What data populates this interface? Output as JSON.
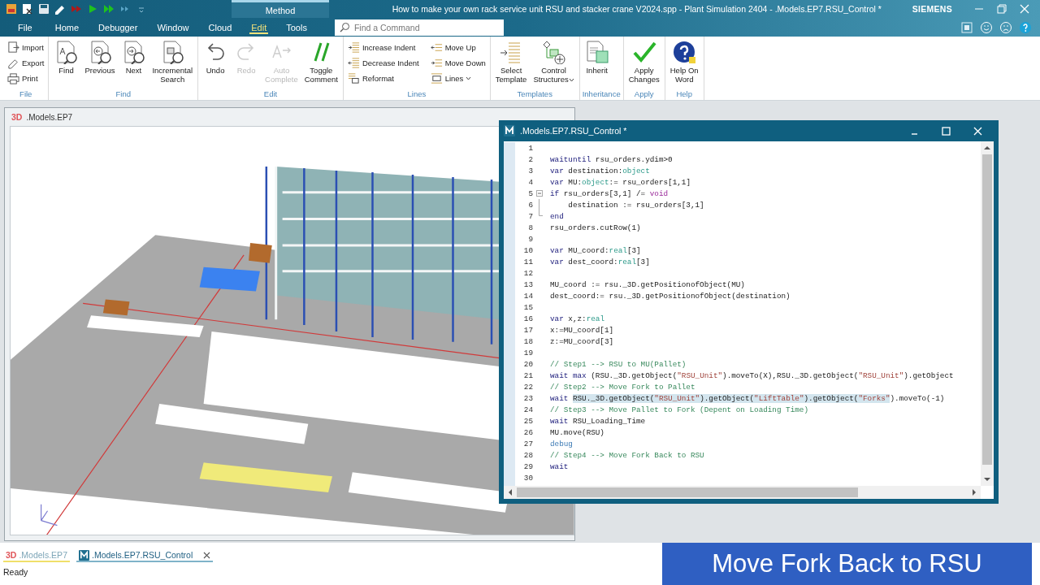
{
  "title_bar": {
    "context_tab": "Method",
    "title": "How to make your own rack service unit RSU and stacker crane V2024.spp - Plant Simulation 2404 - .Models.EP7.RSU_Control *",
    "brand": "SIEMENS"
  },
  "ribbon": {
    "tabs": [
      {
        "label": "File",
        "selected": false
      },
      {
        "label": "Home",
        "selected": false
      },
      {
        "label": "Debugger",
        "selected": false
      },
      {
        "label": "Window",
        "selected": false
      },
      {
        "label": "Cloud",
        "selected": false
      },
      {
        "label": "Edit",
        "selected": true
      },
      {
        "label": "Tools",
        "selected": false
      }
    ],
    "search": {
      "placeholder": "Find a Command"
    },
    "groups": [
      {
        "label": "File",
        "buttons": [
          {
            "kind": "small",
            "label": "Import",
            "disabled": false,
            "dropdown": false
          },
          {
            "kind": "small",
            "label": "Export",
            "disabled": false,
            "dropdown": false
          },
          {
            "kind": "small",
            "label": "Print",
            "disabled": false,
            "dropdown": false
          }
        ]
      },
      {
        "label": "Find",
        "buttons": [
          {
            "kind": "large",
            "label": "Find",
            "disabled": false,
            "dropdown": false
          },
          {
            "kind": "large",
            "label": "Previous",
            "disabled": false,
            "dropdown": false
          },
          {
            "kind": "large",
            "label": "Next",
            "disabled": false,
            "dropdown": false
          },
          {
            "kind": "large",
            "label": "Incremental\nSearch",
            "disabled": false,
            "dropdown": false
          }
        ]
      },
      {
        "label": "Edit",
        "buttons": [
          {
            "kind": "large",
            "label": "Undo",
            "disabled": false,
            "dropdown": false
          },
          {
            "kind": "large",
            "label": "Redo",
            "disabled": true,
            "dropdown": false
          },
          {
            "kind": "large",
            "label": "Auto\nComplete",
            "disabled": true,
            "dropdown": false
          },
          {
            "kind": "large",
            "label": "Toggle\nComment",
            "disabled": false,
            "dropdown": false
          }
        ]
      },
      {
        "label": "Lines",
        "buttons": [
          {
            "kind": "small",
            "label": "Increase Indent",
            "disabled": false,
            "dropdown": false
          },
          {
            "kind": "small",
            "label": "Decrease Indent",
            "disabled": false,
            "dropdown": false
          },
          {
            "kind": "small",
            "label": "Reformat",
            "disabled": false,
            "dropdown": false
          },
          {
            "kind": "small",
            "label": "Move Up",
            "disabled": false,
            "dropdown": false
          },
          {
            "kind": "small",
            "label": "Move Down",
            "disabled": false,
            "dropdown": false
          },
          {
            "kind": "small",
            "label": "Lines",
            "disabled": false,
            "dropdown": true
          }
        ]
      },
      {
        "label": "Templates",
        "buttons": [
          {
            "kind": "large",
            "label": "Select\nTemplate",
            "disabled": false,
            "dropdown": false
          },
          {
            "kind": "large",
            "label": "Control\nStructures",
            "disabled": false,
            "dropdown": true
          }
        ]
      },
      {
        "label": "Inheritance",
        "buttons": [
          {
            "kind": "large",
            "label": "Inherit",
            "disabled": false,
            "dropdown": false
          }
        ]
      },
      {
        "label": "Apply",
        "buttons": [
          {
            "kind": "large",
            "label": "Apply\nChanges",
            "disabled": false,
            "dropdown": false
          }
        ]
      },
      {
        "label": "Help",
        "buttons": [
          {
            "kind": "large",
            "label": "Help On\nWord",
            "disabled": false,
            "dropdown": false
          }
        ]
      }
    ]
  },
  "view_3d": {
    "badge": "3D",
    "title": ".Models.EP7",
    "kind": "picture"
  },
  "editor": {
    "title": ".Models.EP7.RSU_Control *",
    "lines": [
      {
        "number": "1"
      },
      {
        "number": "2",
        "tokens": [
          {
            "kind": "keyword",
            "text": "waituntil"
          },
          {
            "kind": "plain",
            "text": " rsu_orders.ydim>0"
          }
        ]
      },
      {
        "number": "3",
        "tokens": [
          {
            "kind": "keyword",
            "text": "var"
          },
          {
            "kind": "plain",
            "text": " destination:"
          },
          {
            "kind": "type",
            "text": "object"
          }
        ]
      },
      {
        "number": "4",
        "tokens": [
          {
            "kind": "keyword",
            "text": "var"
          },
          {
            "kind": "plain",
            "text": " MU:"
          },
          {
            "kind": "type",
            "text": "object"
          },
          {
            "kind": "plain",
            "text": ":= rsu_orders[1,1]"
          }
        ]
      },
      {
        "number": "5",
        "expanded": true,
        "tokens": [
          {
            "kind": "keyword",
            "text": "if"
          },
          {
            "kind": "plain",
            "text": " rsu_orders[3,1] /= "
          },
          {
            "kind": "constant",
            "text": "void"
          }
        ],
        "children": [
          {
            "number": "6",
            "tokens": [
              {
                "kind": "plain",
                "text": "    destination := rsu_orders[3,1]"
              }
            ]
          },
          {
            "number": "7",
            "tokens": [
              {
                "kind": "keyword",
                "text": "end"
              }
            ]
          }
        ]
      },
      {
        "number": "8",
        "tokens": [
          {
            "kind": "plain",
            "text": "rsu_orders.cutRow(1)"
          }
        ]
      },
      {
        "number": "9"
      },
      {
        "number": "10",
        "tokens": [
          {
            "kind": "keyword",
            "text": "var"
          },
          {
            "kind": "plain",
            "text": " MU_coord:"
          },
          {
            "kind": "type",
            "text": "real"
          },
          {
            "kind": "plain",
            "text": "[3]"
          }
        ]
      },
      {
        "number": "11",
        "tokens": [
          {
            "kind": "keyword",
            "text": "var"
          },
          {
            "kind": "plain",
            "text": " dest_coord:"
          },
          {
            "kind": "type",
            "text": "real"
          },
          {
            "kind": "plain",
            "text": "[3]"
          }
        ]
      },
      {
        "number": "12"
      },
      {
        "number": "13",
        "tokens": [
          {
            "kind": "plain",
            "text": "MU_coord := rsu._3D.getPositionofObject(MU)"
          }
        ]
      },
      {
        "number": "14",
        "tokens": [
          {
            "kind": "plain",
            "text": "dest_coord:= rsu._3D.getPositionofObject(destination)"
          }
        ]
      },
      {
        "number": "15"
      },
      {
        "number": "16",
        "tokens": [
          {
            "kind": "keyword",
            "text": "var"
          },
          {
            "kind": "plain",
            "text": " x,z:"
          },
          {
            "kind": "type",
            "text": "real"
          }
        ]
      },
      {
        "number": "17",
        "tokens": [
          {
            "kind": "plain",
            "text": "x:=MU_coord[1]"
          }
        ]
      },
      {
        "number": "18",
        "tokens": [
          {
            "kind": "plain",
            "text": "z:=MU_coord[3]"
          }
        ]
      },
      {
        "number": "19"
      },
      {
        "number": "20",
        "tokens": [
          {
            "kind": "comment",
            "text": "// Step1 --> RSU to MU(Pallet)"
          }
        ]
      },
      {
        "number": "21",
        "tokens": [
          {
            "kind": "keyword",
            "text": "wait "
          },
          {
            "kind": "keyword",
            "text": "max"
          },
          {
            "kind": "plain",
            "text": " (RSU._3D.getObject("
          },
          {
            "kind": "string",
            "text": "\"RSU_Unit\""
          },
          {
            "kind": "plain",
            "text": ").moveTo(X),RSU._3D.getObject("
          },
          {
            "kind": "string",
            "text": "\"RSU_Unit\""
          },
          {
            "kind": "plain",
            "text": ").getObject"
          }
        ]
      },
      {
        "number": "22",
        "tokens": [
          {
            "kind": "comment",
            "text": "// Step2 --> Move Fork to Pallet"
          }
        ]
      },
      {
        "number": "23",
        "tokens": [
          {
            "kind": "keyword",
            "text": "wait ",
            "selected": false
          },
          {
            "kind": "plain",
            "text": "RSU._3D.getObject(",
            "selected": true
          },
          {
            "kind": "string",
            "text": "\"RSU_Unit\"",
            "selected": true
          },
          {
            "kind": "plain",
            "text": ").getObject(",
            "selected": true
          },
          {
            "kind": "string",
            "text": "\"LiftTable\"",
            "selected": true
          },
          {
            "kind": "plain",
            "text": ").getObject(",
            "selected": true
          },
          {
            "kind": "string",
            "text": "\"Forks\"",
            "selected": true
          },
          {
            "kind": "plain",
            "text": ").moveTo(-1)",
            "selected": false
          }
        ]
      },
      {
        "number": "24",
        "tokens": [
          {
            "kind": "comment",
            "text": "// Step3 --> Move Pallet to Fork (Depent on Loading Time)"
          }
        ]
      },
      {
        "number": "25",
        "tokens": [
          {
            "kind": "keyword",
            "text": "wait"
          },
          {
            "kind": "plain",
            "text": " RSU_Loading_Time"
          }
        ]
      },
      {
        "number": "26",
        "tokens": [
          {
            "kind": "plain",
            "text": "MU.move(RSU)"
          }
        ]
      },
      {
        "number": "27",
        "tokens": [
          {
            "kind": "debug",
            "text": "debug"
          }
        ]
      },
      {
        "number": "28",
        "tokens": [
          {
            "kind": "comment",
            "text": "// Step4 --> Move Fork Back to RSU"
          }
        ]
      },
      {
        "number": "29",
        "tokens": [
          {
            "kind": "keyword",
            "text": "wait"
          }
        ]
      },
      {
        "number": "30"
      }
    ]
  },
  "doc_tabs": [
    {
      "kind": "view",
      "badge": "3D",
      "label": ".Models.EP7",
      "selected": false
    },
    {
      "kind": "method",
      "label": ".Models.EP7.RSU_Control",
      "selected": true
    }
  ],
  "status_bar": {
    "text": "Ready"
  },
  "caption": "Move Fork Back to RSU"
}
